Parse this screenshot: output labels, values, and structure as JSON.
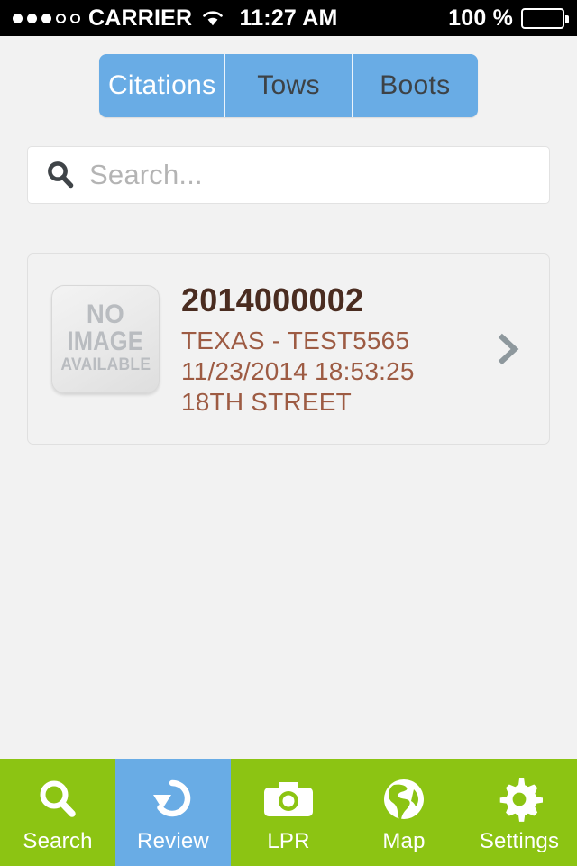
{
  "statusbar": {
    "signal_filled": 3,
    "signal_empty": 2,
    "carrier": "CARRIER",
    "wifi_icon": "wifi-icon",
    "time": "11:27 AM",
    "battery_percent": "100 %",
    "battery_icon": "battery-icon"
  },
  "segmented": {
    "items": [
      {
        "label": "Citations",
        "active": true
      },
      {
        "label": "Tows",
        "active": false
      },
      {
        "label": "Boots",
        "active": false
      }
    ]
  },
  "search": {
    "icon": "search-icon",
    "placeholder": "Search...",
    "value": ""
  },
  "list": {
    "items": [
      {
        "thumb_line1": "NO",
        "thumb_line2": "IMAGE",
        "thumb_line3": "AVAILABLE",
        "title": "2014000002",
        "line1": "TEXAS - TEST5565",
        "line2": "11/23/2014 18:53:25",
        "line3": "18TH STREET",
        "chevron": "chevron-right-icon"
      }
    ]
  },
  "tabbar": {
    "items": [
      {
        "label": "Search",
        "icon": "search-icon",
        "active": false
      },
      {
        "label": "Review",
        "icon": "undo-arrow-icon",
        "active": true
      },
      {
        "label": "LPR",
        "icon": "camera-icon",
        "active": false
      },
      {
        "label": "Map",
        "icon": "globe-icon",
        "active": false
      },
      {
        "label": "Settings",
        "icon": "gear-icon",
        "active": false
      }
    ]
  },
  "colors": {
    "accent_blue": "#69ace5",
    "accent_green": "#8cc413",
    "title_brown": "#4a2c20",
    "detail_brown": "#9d5b43",
    "background": "#f2f2f2"
  }
}
